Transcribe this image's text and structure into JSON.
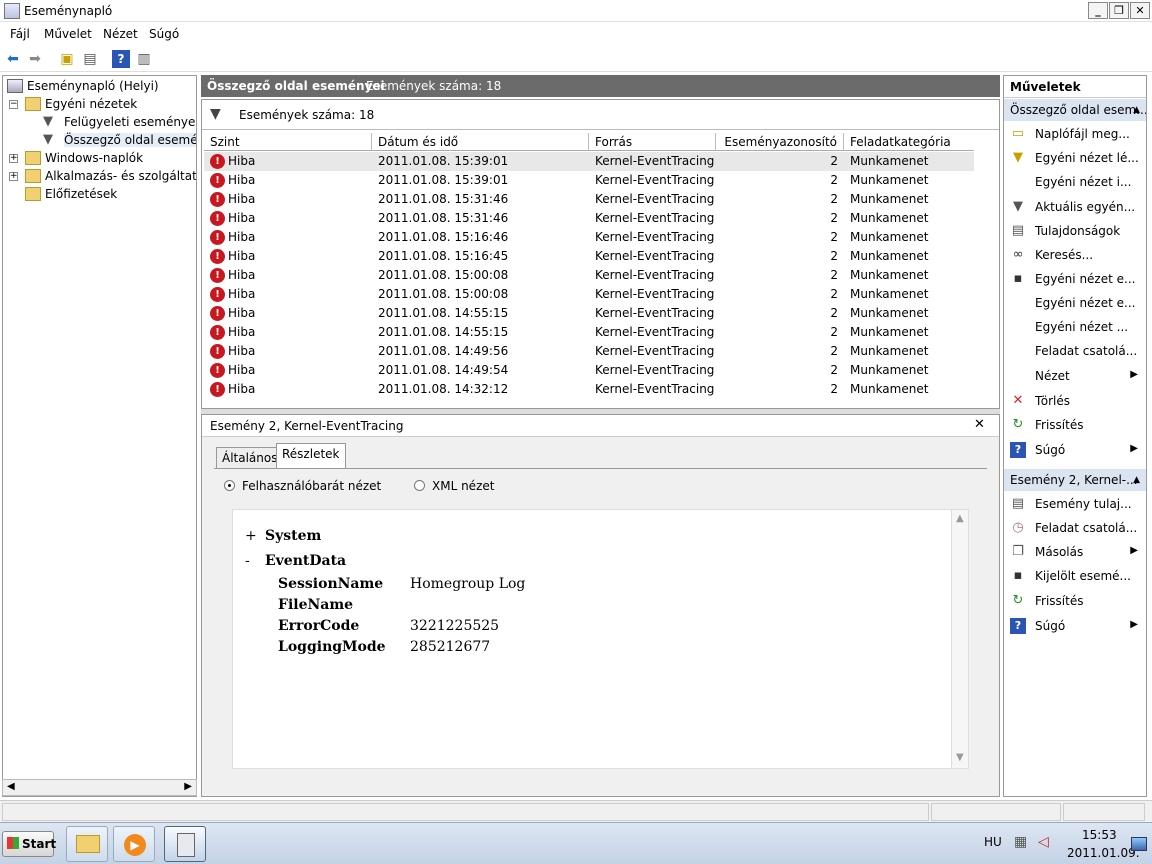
{
  "window": {
    "title": "Eseménynapló"
  },
  "menu": [
    "Fájl",
    "Művelet",
    "Nézet",
    "Súgó"
  ],
  "tree": {
    "root": "Eseménynapló (Helyi)",
    "custom_views": "Egyéni nézetek",
    "admin_events": "Felügyeleti események",
    "summary_events": "Összegző oldal eseményei",
    "windows_logs": "Windows-naplók",
    "app_logs": "Alkalmazás- és szolgáltatásnaplók",
    "subscriptions": "Előfizetések"
  },
  "center": {
    "header_title": "Összegző oldal eseményei",
    "header_count": "Események száma: 18",
    "filter_text": "Események száma: 18",
    "columns": [
      "Szint",
      "Dátum és idő",
      "Forrás",
      "Eseményazonosító",
      "Feladatkategória"
    ],
    "rows": [
      {
        "level": "Hiba",
        "date": "2011.01.08. 15:39:01",
        "source": "Kernel-EventTracing",
        "id": "2",
        "task": "Munkamenet"
      },
      {
        "level": "Hiba",
        "date": "2011.01.08. 15:39:01",
        "source": "Kernel-EventTracing",
        "id": "2",
        "task": "Munkamenet"
      },
      {
        "level": "Hiba",
        "date": "2011.01.08. 15:31:46",
        "source": "Kernel-EventTracing",
        "id": "2",
        "task": "Munkamenet"
      },
      {
        "level": "Hiba",
        "date": "2011.01.08. 15:31:46",
        "source": "Kernel-EventTracing",
        "id": "2",
        "task": "Munkamenet"
      },
      {
        "level": "Hiba",
        "date": "2011.01.08. 15:16:46",
        "source": "Kernel-EventTracing",
        "id": "2",
        "task": "Munkamenet"
      },
      {
        "level": "Hiba",
        "date": "2011.01.08. 15:16:45",
        "source": "Kernel-EventTracing",
        "id": "2",
        "task": "Munkamenet"
      },
      {
        "level": "Hiba",
        "date": "2011.01.08. 15:00:08",
        "source": "Kernel-EventTracing",
        "id": "2",
        "task": "Munkamenet"
      },
      {
        "level": "Hiba",
        "date": "2011.01.08. 15:00:08",
        "source": "Kernel-EventTracing",
        "id": "2",
        "task": "Munkamenet"
      },
      {
        "level": "Hiba",
        "date": "2011.01.08. 14:55:15",
        "source": "Kernel-EventTracing",
        "id": "2",
        "task": "Munkamenet"
      },
      {
        "level": "Hiba",
        "date": "2011.01.08. 14:55:15",
        "source": "Kernel-EventTracing",
        "id": "2",
        "task": "Munkamenet"
      },
      {
        "level": "Hiba",
        "date": "2011.01.08. 14:49:56",
        "source": "Kernel-EventTracing",
        "id": "2",
        "task": "Munkamenet"
      },
      {
        "level": "Hiba",
        "date": "2011.01.08. 14:49:54",
        "source": "Kernel-EventTracing",
        "id": "2",
        "task": "Munkamenet"
      },
      {
        "level": "Hiba",
        "date": "2011.01.08. 14:32:12",
        "source": "Kernel-EventTracing",
        "id": "2",
        "task": "Munkamenet"
      }
    ]
  },
  "detail": {
    "title": "Esemény 2, Kernel-EventTracing",
    "tab_general": "Általános",
    "tab_details": "Részletek",
    "radio_friendly": "Felhasználóbarát nézet",
    "radio_xml": "XML nézet",
    "system_label": "System",
    "eventdata_label": "EventData",
    "fields": [
      {
        "key": "SessionName",
        "value": "Homegroup Log"
      },
      {
        "key": "FileName",
        "value": ""
      },
      {
        "key": "ErrorCode",
        "value": "3221225525"
      },
      {
        "key": "LoggingMode",
        "value": "285212677"
      }
    ]
  },
  "actions": {
    "title": "Műveletek",
    "section1_title": "Összegző oldal esem...",
    "section1_items": [
      {
        "label": "Naplófájl meg...",
        "icon": "folder-open-icon",
        "submenu": false
      },
      {
        "label": "Egyéni nézet lé...",
        "icon": "filter-create-icon",
        "submenu": false
      },
      {
        "label": "Egyéni nézet i...",
        "icon": "",
        "submenu": false
      },
      {
        "label": "Aktuális egyén...",
        "icon": "filter-icon",
        "submenu": false
      },
      {
        "label": "Tulajdonságok",
        "icon": "properties-icon",
        "submenu": false
      },
      {
        "label": "Keresés...",
        "icon": "binoculars-icon",
        "submenu": false
      },
      {
        "label": "Egyéni nézet e...",
        "icon": "save-icon",
        "submenu": false
      },
      {
        "label": "Egyéni nézet e...",
        "icon": "",
        "submenu": false
      },
      {
        "label": "Egyéni nézet ...",
        "icon": "",
        "submenu": false
      },
      {
        "label": "Feladat csatolá...",
        "icon": "",
        "submenu": false
      },
      {
        "label": "Nézet",
        "icon": "",
        "submenu": true
      },
      {
        "label": "Törlés",
        "icon": "delete-icon",
        "submenu": false
      },
      {
        "label": "Frissítés",
        "icon": "refresh-icon",
        "submenu": false
      },
      {
        "label": "Súgó",
        "icon": "help-icon",
        "submenu": true
      }
    ],
    "section2_title": "Esemény 2, Kernel-...",
    "section2_items": [
      {
        "label": "Esemény tulaj...",
        "icon": "event-properties-icon",
        "submenu": false
      },
      {
        "label": "Feladat csatolá...",
        "icon": "task-icon",
        "submenu": false
      },
      {
        "label": "Másolás",
        "icon": "copy-icon",
        "submenu": true
      },
      {
        "label": "Kijelölt esemé...",
        "icon": "save-icon",
        "submenu": false
      },
      {
        "label": "Frissítés",
        "icon": "refresh-icon",
        "submenu": false
      },
      {
        "label": "Súgó",
        "icon": "help-icon",
        "submenu": true
      }
    ]
  },
  "taskbar": {
    "start_label": "Start",
    "lang": "HU",
    "time": "15:53",
    "date": "2011.01.09."
  },
  "colors": {
    "error": "#c8171f",
    "header_bg": "#6b6b6b",
    "section_bg": "#dbe5f1"
  }
}
